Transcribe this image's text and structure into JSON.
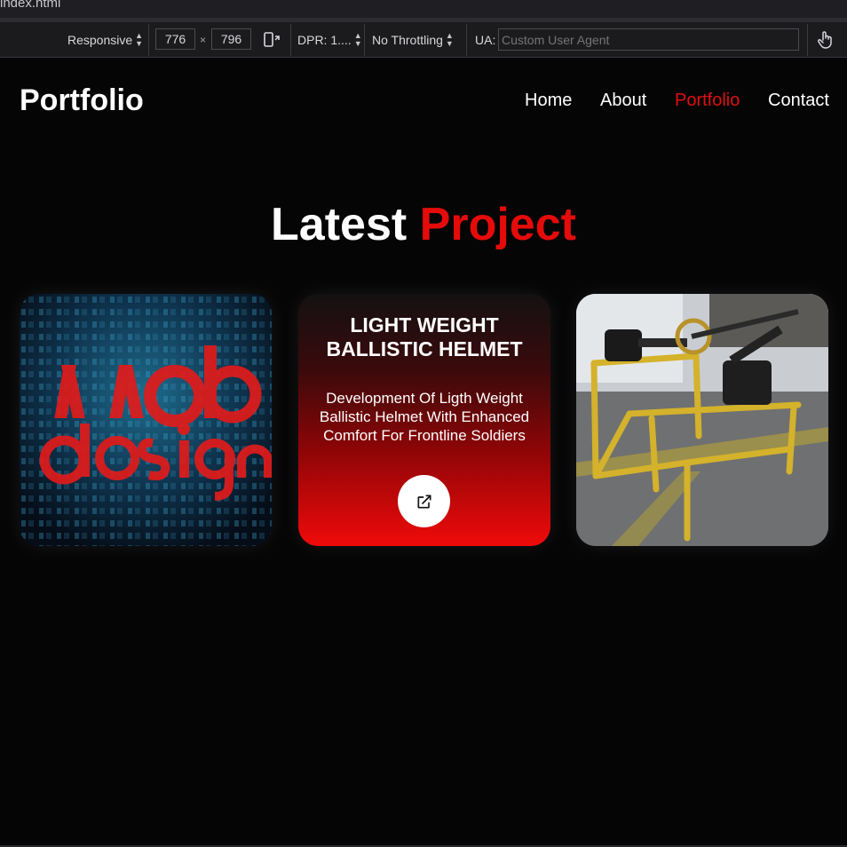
{
  "browser": {
    "tab_title": "index.html"
  },
  "devtools": {
    "device_label": "Responsive",
    "width_value": "776",
    "times": "×",
    "height_value": "796",
    "dpr_label": "DPR: 1....",
    "throttle_label": "No Throttling",
    "ua_label": "UA:",
    "ua_placeholder": "Custom User Agent"
  },
  "site": {
    "logo": "Portfolio",
    "nav": [
      {
        "label": "Home"
      },
      {
        "label": "About"
      },
      {
        "label": "Portfolio",
        "active": true
      },
      {
        "label": "Contact"
      }
    ],
    "heading_main": "Latest",
    "heading_accent": "Project",
    "accent_color": "#e60b0b",
    "projects": [
      {
        "image": "web-design-poster"
      },
      {
        "title": "LIGHT WEIGHT BALLISTIC HELMET",
        "description": "Development Of Ligth Weight Ballistic Helmet With Enhanced Comfort For Frontline Soldiers",
        "link_icon": "external-link-icon"
      },
      {
        "image": "yellow-metal-frame-machine"
      }
    ]
  }
}
